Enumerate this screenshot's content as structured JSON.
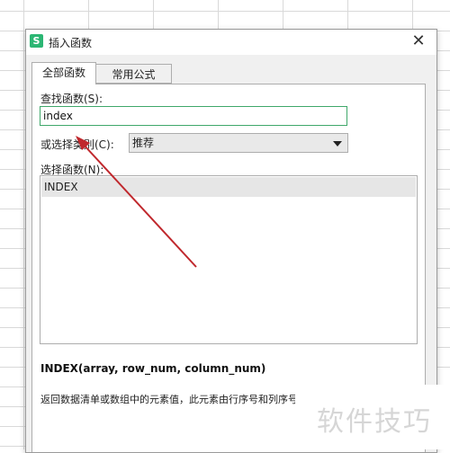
{
  "dialog": {
    "title": "插入函数",
    "logo_glyph": "S",
    "close_glyph": "✕"
  },
  "tabs": [
    {
      "label": "全部函数",
      "active": true
    },
    {
      "label": "常用公式",
      "active": false
    }
  ],
  "search": {
    "label": "查找函数(S):",
    "value": "index"
  },
  "category": {
    "label": "或选择类别(C):",
    "selected": "推荐"
  },
  "function_list": {
    "label": "选择函数(N):",
    "items": [
      "INDEX"
    ]
  },
  "details": {
    "signature": "INDEX(array, row_num, column_num)",
    "description": "返回数据清单或数组中的元素值，此元素由行序号和列序号"
  },
  "watermark": {
    "text": "软件技巧"
  },
  "colors": {
    "arrow": "#c0282d",
    "accent": "#2bb673",
    "input_focus": "#3fa86a"
  }
}
